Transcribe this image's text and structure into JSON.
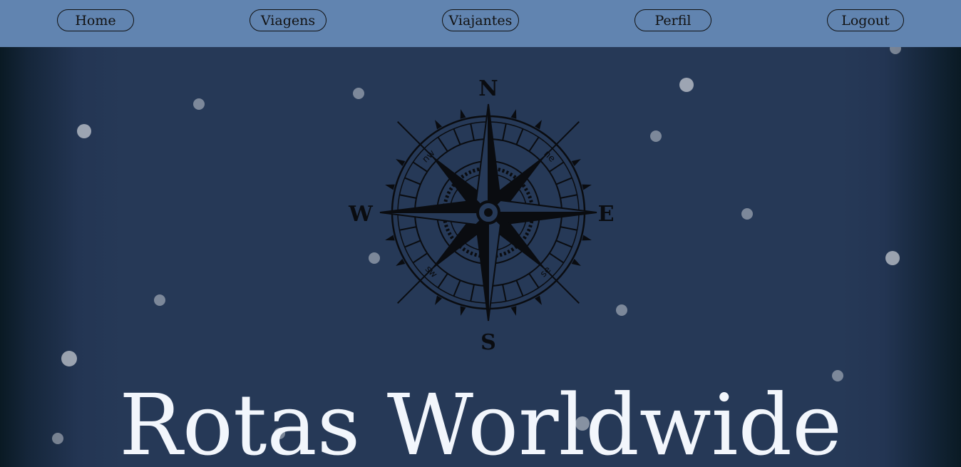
{
  "nav": {
    "items": [
      {
        "label": "Home"
      },
      {
        "label": "Viagens"
      },
      {
        "label": "Viajantes"
      },
      {
        "label": "Perfil"
      },
      {
        "label": "Logout"
      }
    ]
  },
  "compass": {
    "north": "N",
    "south": "S",
    "east": "E",
    "west": "W",
    "northwest": "nw",
    "northeast": "ne",
    "southwest": "sw",
    "southeast": "se"
  },
  "hero": {
    "title": "Rotas Worldwide"
  },
  "colors": {
    "navbar": "#6184b0",
    "background": "#263957",
    "title": "#f2f6fc"
  }
}
